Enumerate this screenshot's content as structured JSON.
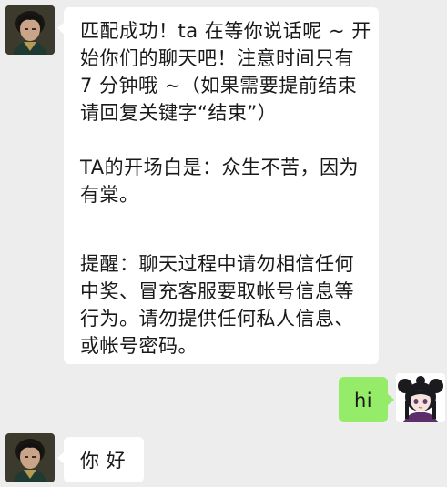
{
  "messages": [
    {
      "side": "left",
      "paragraphs": [
        "匹配成功！ta 在等你说话呢 ~ 开始你们的聊天吧！注意时间只有 7 分钟哦 ~（如果需要提前结束请回复关键字“结束”）",
        "TA的开场白是：众生不苦，因为有棠。",
        "提醒：聊天过程中请勿相信任何中奖、冒充客服要取帐号信息等行为。请勿提供任何私人信息、或帐号密码。"
      ]
    },
    {
      "side": "right",
      "text": "hi"
    },
    {
      "side": "left",
      "text": "你 好"
    }
  ],
  "colors": {
    "background": "#ededed",
    "incoming_bubble": "#ffffff",
    "outgoing_bubble": "#95ec69",
    "text": "#191919"
  },
  "icons": {
    "left_avatar": "avatar-man-dark-hair",
    "right_avatar": "avatar-anime-girl-black-hair"
  }
}
